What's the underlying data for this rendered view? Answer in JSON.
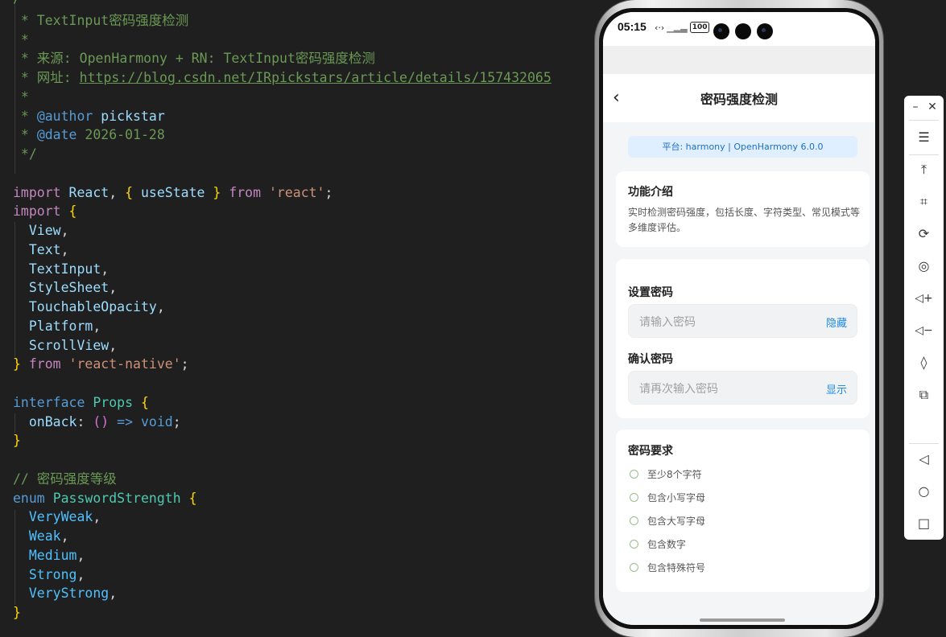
{
  "code": {
    "comment_lines": [
      "/**",
      " * TextInput密码强度检测",
      " *",
      " * 来源: OpenHarmony + RN: TextInput密码强度检测",
      " * 网址: ",
      " *",
      " * ",
      " * ",
      " */"
    ],
    "url": "https://blog.csdn.net/IRpickstars/article/details/157432065",
    "author_tag": "@author",
    "author": "pickstar",
    "date_tag": "@date",
    "date": "2026-01-28",
    "import1": {
      "kw": "import",
      "name": "React",
      "comma": ",",
      "lb": "{",
      "hook": "useState",
      "rb": "}",
      "from": "from",
      "module": "'react'",
      "semi": ";"
    },
    "import2": {
      "kw": "import",
      "lb": "{",
      "names": [
        "View",
        "Text",
        "TextInput",
        "StyleSheet",
        "TouchableOpacity",
        "Platform",
        "ScrollView"
      ],
      "rb": "}",
      "from": "from",
      "module": "'react-native'",
      "semi": ";"
    },
    "interface": {
      "kw": "interface",
      "name": "Props",
      "lb": "{",
      "prop": "onBack",
      "colon": ":",
      "parens": "()",
      "arrow": "=>",
      "type": "void",
      "semi": ";",
      "rb": "}"
    },
    "enum_comment": "// 密码强度等级",
    "enum": {
      "kw": "enum",
      "name": "PasswordStrength",
      "lb": "{",
      "members": [
        "VeryWeak",
        "Weak",
        "Medium",
        "Strong",
        "VeryStrong"
      ],
      "rb": "}"
    }
  },
  "phone": {
    "status": {
      "time": "05:15",
      "battery": "100"
    },
    "title": "密码强度检测",
    "back_icon": "chevron-left-icon",
    "platform": "平台: harmony | OpenHarmony 6.0.0",
    "intro": {
      "title": "功能介绍",
      "desc": "实时检测密码强度，包括长度、字符类型、常见模式等多维度评估。"
    },
    "set_password": {
      "label": "设置密码",
      "placeholder": "请输入密码",
      "toggle": "隐藏"
    },
    "confirm_password": {
      "label": "确认密码",
      "placeholder": "请再次输入密码",
      "toggle": "显示"
    },
    "requirements": {
      "title": "密码要求",
      "items": [
        "至少8个字符",
        "包含小写字母",
        "包含大写字母",
        "包含数字",
        "包含特殊符号"
      ]
    }
  },
  "toolbar": {
    "icons": [
      "minimize-icon",
      "close-icon",
      "menu-icon",
      "pin-top-icon",
      "crop-icon",
      "rotate-icon",
      "screenshot-icon",
      "volume-up-icon",
      "volume-down-icon",
      "shake-icon",
      "multi-device-icon",
      "back-icon",
      "home-icon",
      "recents-icon"
    ]
  },
  "colors": {
    "accent": "#1e8ae6",
    "editor_bg": "#1f1f1f",
    "comment": "#6a9955"
  }
}
